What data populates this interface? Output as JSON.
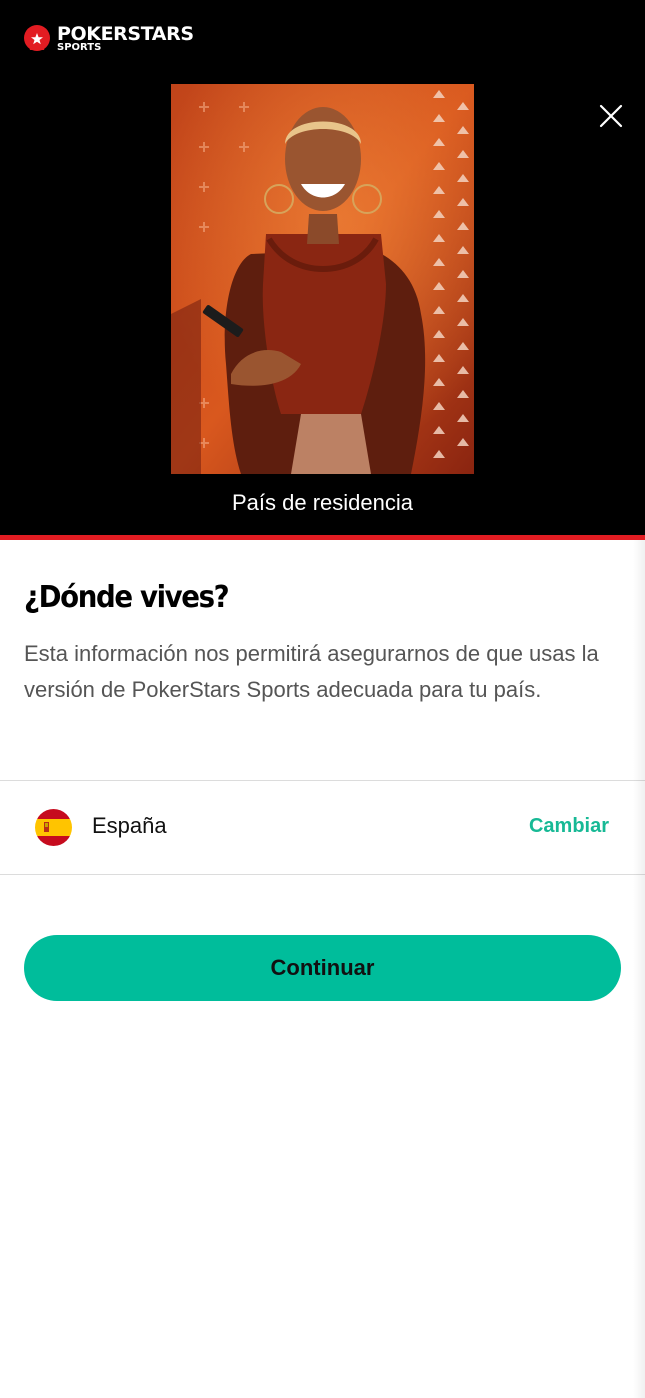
{
  "brand": {
    "name": "POKERSTARS",
    "sub": "SPORTS",
    "accent_red": "#e21c22"
  },
  "header": {
    "caption": "País de residencia",
    "close_icon": "close-icon"
  },
  "main": {
    "title": "¿Dónde vives?",
    "description": "Esta información nos permitirá asegurarnos de que usas la versión de PokerStars Sports adecuada para tu país.",
    "country": {
      "name": "España",
      "flag_icon": "spain-flag-icon",
      "change_label": "Cambiar"
    },
    "continue_label": "Continuar",
    "primary_color": "#00bd9b",
    "link_color": "#17b995"
  }
}
